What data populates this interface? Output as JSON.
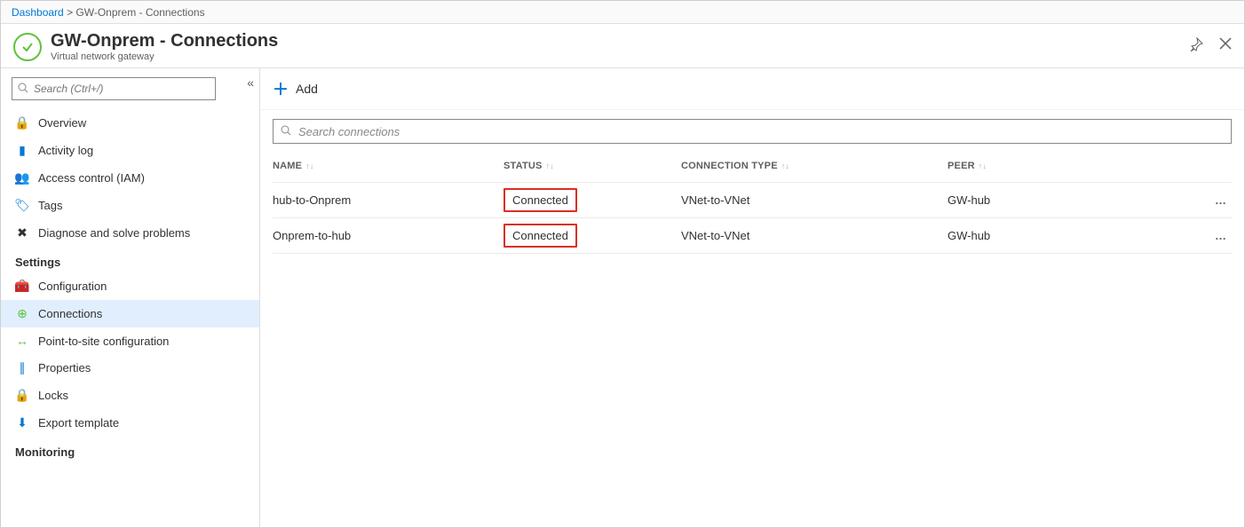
{
  "breadcrumb": {
    "root": "Dashboard",
    "current": "GW-Onprem - Connections"
  },
  "header": {
    "title": "GW-Onprem - Connections",
    "subtitle": "Virtual network gateway"
  },
  "sidebar": {
    "search_placeholder": "Search (Ctrl+/)",
    "items": [
      {
        "label": "Overview",
        "icon": "🔒",
        "color": "ic-blue"
      },
      {
        "label": "Activity log",
        "icon": "▮",
        "color": "ic-blue"
      },
      {
        "label": "Access control (IAM)",
        "icon": "👥",
        "color": "ic-blue"
      },
      {
        "label": "Tags",
        "icon": "🏷",
        "color": "ic-blue"
      },
      {
        "label": "Diagnose and solve problems",
        "icon": "✖",
        "color": "ic-ink"
      }
    ],
    "section_settings": "Settings",
    "settings_items": [
      {
        "label": "Configuration",
        "icon": "🧰",
        "color": "ic-red"
      },
      {
        "label": "Connections",
        "icon": "⊕",
        "color": "ic-green",
        "active": true
      },
      {
        "label": "Point-to-site configuration",
        "icon": "↔",
        "color": "ic-green"
      },
      {
        "label": "Properties",
        "icon": "∥",
        "color": "ic-blue"
      },
      {
        "label": "Locks",
        "icon": "🔒",
        "color": "ic-ink"
      },
      {
        "label": "Export template",
        "icon": "⬇",
        "color": "ic-blue"
      }
    ],
    "section_monitoring": "Monitoring"
  },
  "toolbar": {
    "add_label": "Add"
  },
  "main_search_placeholder": "Search connections",
  "columns": {
    "name": "NAME",
    "status": "STATUS",
    "type": "CONNECTION TYPE",
    "peer": "PEER"
  },
  "rows": [
    {
      "name": "hub-to-Onprem",
      "status": "Connected",
      "type": "VNet-to-VNet",
      "peer": "GW-hub"
    },
    {
      "name": "Onprem-to-hub",
      "status": "Connected",
      "type": "VNet-to-VNet",
      "peer": "GW-hub"
    }
  ]
}
